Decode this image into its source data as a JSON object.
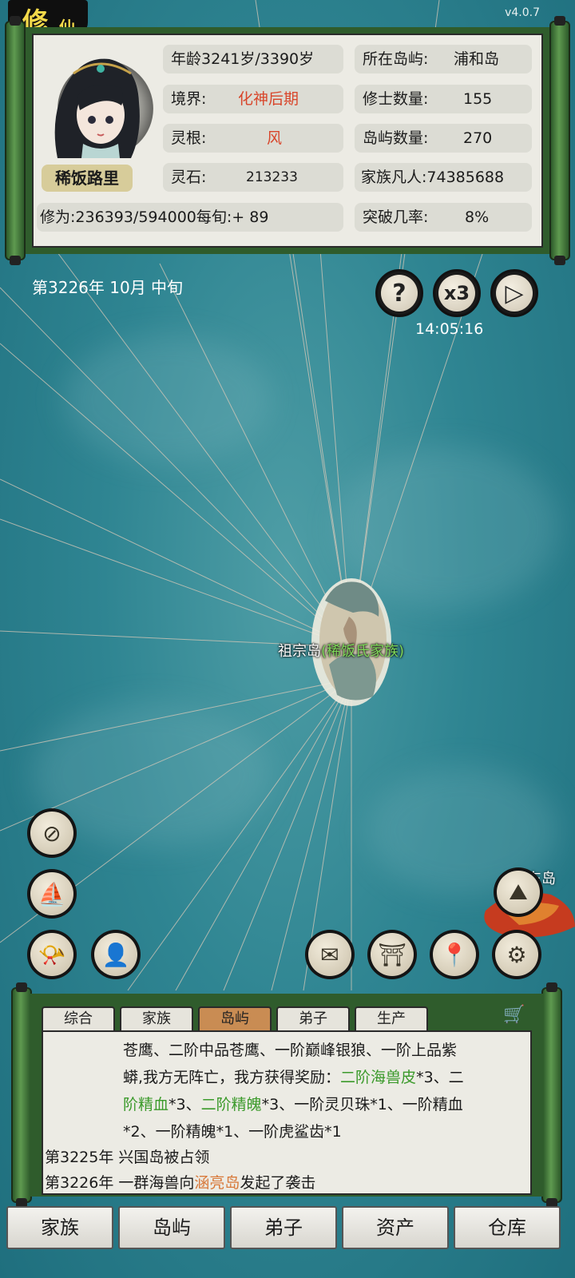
{
  "header": {
    "title_big": "修",
    "title_small": "仙",
    "version": "v4.0.7"
  },
  "character": {
    "name": "稀饭路里",
    "age_label": "年龄",
    "age_value": "3241岁/3390岁",
    "realm_label": "境界:",
    "realm_value": "化神后期",
    "root_label": "灵根:",
    "root_value": "风",
    "stones_label": "灵石:",
    "stones_value": "213233",
    "cultivation_label": "修为:",
    "cultivation_value": "236393/594000每旬:+ 89"
  },
  "island_info": {
    "location_label": "所在岛屿:",
    "location_value": "浦和岛",
    "cultivators_label": "修士数量:",
    "cultivators_value": "155",
    "islands_label": "岛屿数量:",
    "islands_value": "270",
    "mortals_label": "家族凡人:",
    "mortals_value": "74385688",
    "breakthrough_label": "突破几率:",
    "breakthrough_value": "8%"
  },
  "time": {
    "date": "第3226年 10月 中旬",
    "clock": "14:05:16",
    "speed_label": "x3"
  },
  "map": {
    "home_island_name": "祖宗岛",
    "home_island_family": "(稀饭氏家族)",
    "far_island_label": "东岛"
  },
  "log": {
    "tabs": [
      "综合",
      "家族",
      "岛屿",
      "弟子",
      "生产"
    ],
    "active_tab": "岛屿",
    "lines": [
      {
        "text": "苍鹰、二阶中品苍鹰、一阶巅峰银狼、一阶上品紫"
      },
      {
        "text": "蟒,我方无阵亡，我方获得奖励："
      },
      {
        "text": "二阶海兽皮"
      },
      {
        "text": "*3、二"
      },
      {
        "text": "阶精血"
      },
      {
        "text": "*3、"
      },
      {
        "text": "二阶精魄"
      },
      {
        "text": "*3、一阶灵贝珠*1、一阶精血"
      },
      {
        "text": "*2、一阶精魄*1、一阶虎鲨齿*1"
      },
      {
        "text": "第3225年 兴国岛被占领"
      },
      {
        "text": "第3226年 一群海兽向"
      },
      {
        "text": "涵亮岛"
      },
      {
        "text": "发起了袭击"
      }
    ]
  },
  "bottom_nav": [
    "家族",
    "岛屿",
    "弟子",
    "资产",
    "仓库"
  ],
  "colors": {
    "sea": "#2f8592",
    "scroll_green": "#2f5c2c",
    "paper": "#ecebe4",
    "highlight_red": "#d8452a",
    "highlight_green": "#3b9a2b",
    "highlight_orange": "#d8793a",
    "active_tab": "#c98c53"
  }
}
